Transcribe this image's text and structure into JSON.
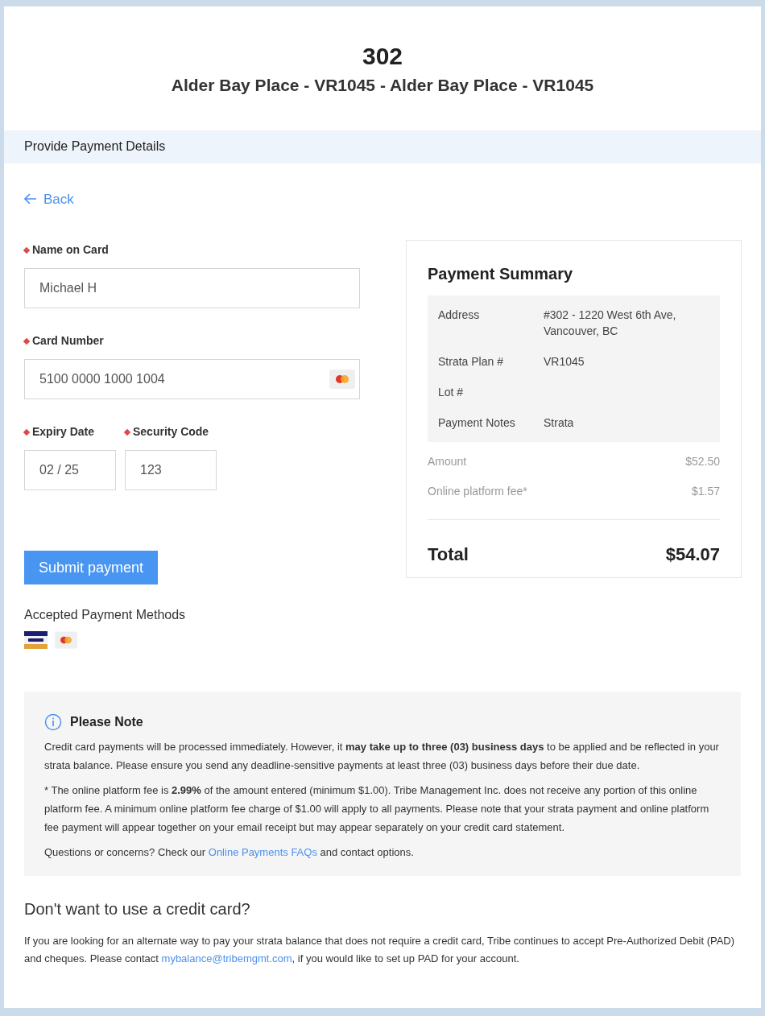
{
  "header": {
    "title": "302",
    "subtitle": "Alder Bay Place - VR1045 - Alder Bay Place - VR1045"
  },
  "section_bar": {
    "title": "Provide Payment Details"
  },
  "back_link": {
    "label": "Back"
  },
  "form": {
    "name_on_card": {
      "label": "Name on Card",
      "required": true,
      "value": "Michael H"
    },
    "card_number": {
      "label": "Card Number",
      "required": true,
      "value": "5100 0000 1000 1004"
    },
    "expiry_date": {
      "label": "Expiry Date",
      "required": true,
      "value": "02 / 25"
    },
    "security_code": {
      "label": "Security Code",
      "required": true,
      "value": "123"
    },
    "submit_button": {
      "label": "Submit payment"
    },
    "accepted_methods": {
      "title": "Accepted Payment Methods"
    }
  },
  "summary": {
    "title": "Payment Summary",
    "details": [
      {
        "label": "Address",
        "value": "#302 - 1220 West 6th Ave, Vancouver, BC"
      },
      {
        "label": "Strata Plan #",
        "value": "VR1045"
      },
      {
        "label": "Lot #"
      },
      {
        "label": "Payment Notes",
        "value": "Strata"
      }
    ],
    "lines": [
      {
        "label": "Amount",
        "value": "$52.50"
      },
      {
        "label": "Online platform fee*",
        "value": "$1.57"
      }
    ],
    "total": {
      "label": "Total",
      "value": "$54.07"
    }
  },
  "note": {
    "title": "Please Note",
    "paragraphs": [
      "Credit card payments will be processed immediately. However, it **may take up to three (03) business days** to be applied and be reflected in your strata balance. Please ensure you send any deadline-sensitive payments at least three (03) business days before their due date.",
      "* The online platform fee is **2.99%** of the amount entered (minimum $1.00). Tribe Management Inc. does not receive any portion of this online platform fee. A minimum online platform fee charge of $1.00 will apply to all payments. Please note that your strata payment and online platform fee payment will appear together on your email receipt but may appear separately on your credit card statement."
    ],
    "questions": {
      "before": "Questions or concerns? Check our ",
      "link": "Online Payments FAQs",
      "after": " and contact options."
    }
  },
  "alternative": {
    "title": "Don't want to use a credit card?",
    "text": {
      "before": "If you are looking for an alternate way to pay your strata balance that does not require a credit card, Tribe continues to accept Pre-Authorized Debit (PAD) and cheques. Please contact ",
      "link": "mybalance@tribemgmt.com",
      "after": ", if you would like to set up PAD for your account."
    }
  }
}
